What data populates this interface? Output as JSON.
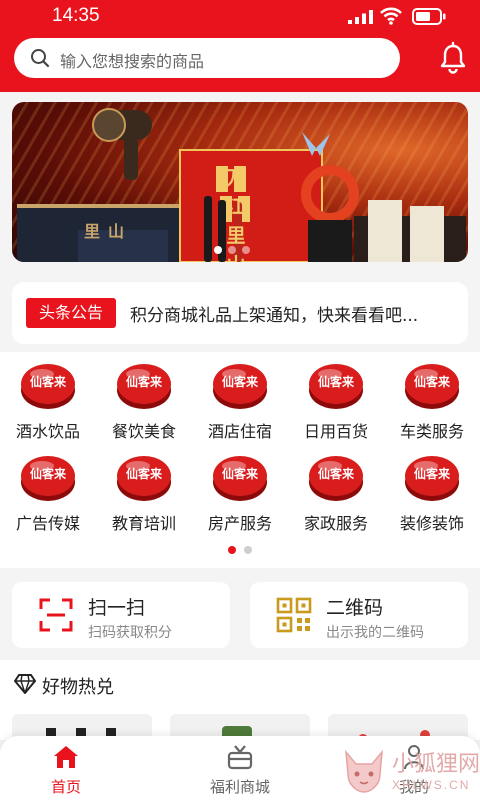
{
  "status": {
    "time": "14:35"
  },
  "search": {
    "placeholder": "输入您想搜索的商品"
  },
  "banner": {
    "sign_text": "万江里山",
    "box_text": "里山"
  },
  "notice": {
    "tag": "头条公告",
    "text": "积分商城礼品上架通知，快来看看吧..."
  },
  "categories": [
    {
      "label": "酒水饮品",
      "badge": "仙客来"
    },
    {
      "label": "餐饮美食",
      "badge": "仙客来"
    },
    {
      "label": "酒店住宿",
      "badge": "仙客来"
    },
    {
      "label": "日用百货",
      "badge": "仙客来"
    },
    {
      "label": "车类服务",
      "badge": "仙客来"
    },
    {
      "label": "广告传媒",
      "badge": "仙客来"
    },
    {
      "label": "教育培训",
      "badge": "仙客来"
    },
    {
      "label": "房产服务",
      "badge": "仙客来"
    },
    {
      "label": "家政服务",
      "badge": "仙客来"
    },
    {
      "label": "装修装饰",
      "badge": "仙客来"
    }
  ],
  "pager": {
    "pages": 2,
    "current": 1
  },
  "cards": [
    {
      "title": "扫一扫",
      "subtitle": "扫码获取积分",
      "icon": "scan-icon"
    },
    {
      "title": "二维码",
      "subtitle": "出示我的二维码",
      "icon": "qrcode-icon"
    }
  ],
  "hot": {
    "title": "好物热兑"
  },
  "tabs": [
    {
      "label": "首页",
      "icon": "home-icon",
      "active": true
    },
    {
      "label": "福利商城",
      "icon": "gift-icon",
      "active": false
    },
    {
      "label": "我的",
      "icon": "user-icon",
      "active": false
    }
  ],
  "watermark": {
    "text1": "小狐狸网",
    "text2": "XHLWS.CN"
  },
  "colors": {
    "brand": "#e8131c",
    "tab_active": "#e8131c",
    "tab_inactive": "#666666",
    "qr": "#c99a1c"
  }
}
